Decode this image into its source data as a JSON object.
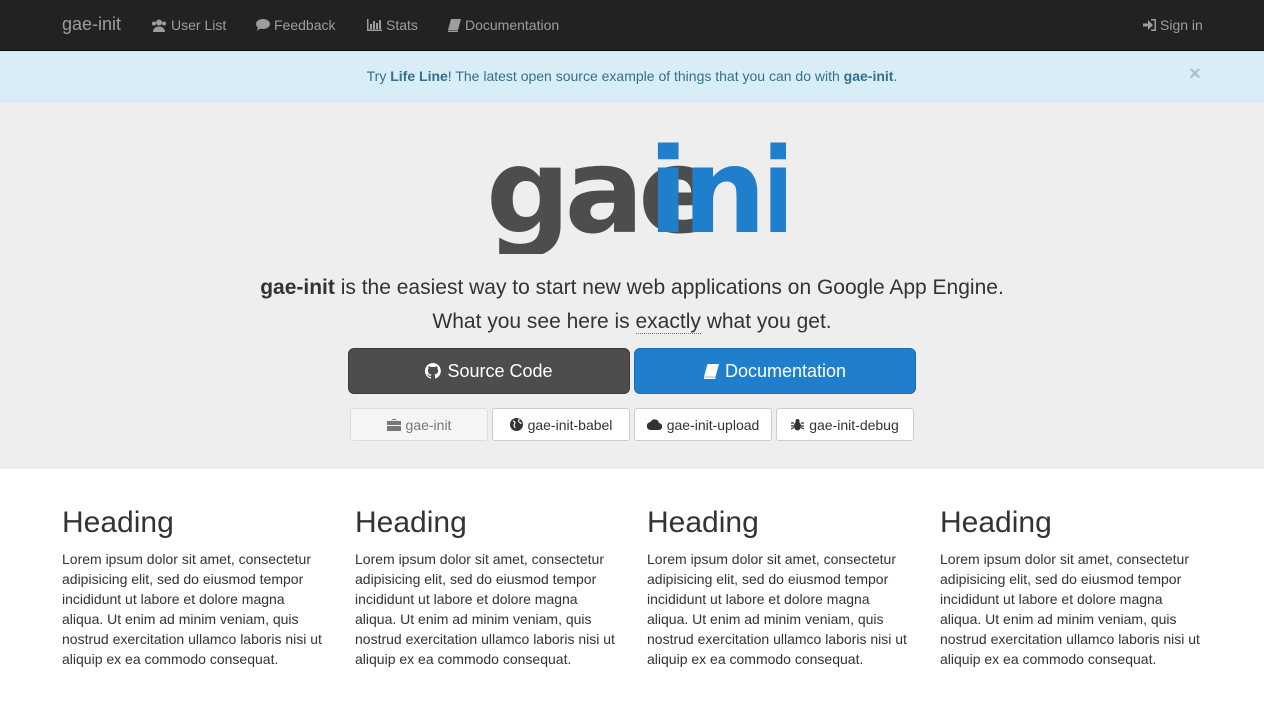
{
  "navbar": {
    "brand": "gae-init",
    "items": [
      {
        "label": "User List",
        "icon": "users-icon"
      },
      {
        "label": "Feedback",
        "icon": "comment-icon"
      },
      {
        "label": "Stats",
        "icon": "bar-chart-icon"
      },
      {
        "label": "Documentation",
        "icon": "book-icon"
      }
    ],
    "signin": {
      "label": "Sign in",
      "icon": "sign-in-icon"
    }
  },
  "alert": {
    "prefix": "Try ",
    "link": "Life Line",
    "middle": "! The latest open source example of things that you can do with ",
    "brand": "gae-init",
    "suffix": ".",
    "close": "×"
  },
  "hero": {
    "logo_part1": "gae",
    "logo_part2": "init",
    "lead_brand": "gae-init",
    "lead_text": " is the easiest way to start new web applications on Google App Engine.",
    "line2_a": "What you see here is ",
    "line2_abbr": "exactly",
    "line2_b": " what you get.",
    "source_button": "Source Code",
    "docs_button": "Documentation",
    "variants": [
      {
        "label": "gae-init",
        "icon": "briefcase-icon",
        "active": true
      },
      {
        "label": "gae-init-babel",
        "icon": "globe-icon",
        "active": false
      },
      {
        "label": "gae-init-upload",
        "icon": "cloud-icon",
        "active": false
      },
      {
        "label": "gae-init-debug",
        "icon": "bug-icon",
        "active": false
      }
    ]
  },
  "columns": [
    {
      "heading": "Heading",
      "text": "Lorem ipsum dolor sit amet, consectetur adipisicing elit, sed do eiusmod tempor incididunt ut labore et dolore magna aliqua. Ut enim ad minim veniam, quis nostrud exercitation ullamco laboris nisi ut aliquip ex ea commodo consequat."
    },
    {
      "heading": "Heading",
      "text": "Lorem ipsum dolor sit amet, consectetur adipisicing elit, sed do eiusmod tempor incididunt ut labore et dolore magna aliqua. Ut enim ad minim veniam, quis nostrud exercitation ullamco laboris nisi ut aliquip ex ea commodo consequat."
    },
    {
      "heading": "Heading",
      "text": "Lorem ipsum dolor sit amet, consectetur adipisicing elit, sed do eiusmod tempor incididunt ut labore et dolore magna aliqua. Ut enim ad minim veniam, quis nostrud exercitation ullamco laboris nisi ut aliquip ex ea commodo consequat."
    },
    {
      "heading": "Heading",
      "text": "Lorem ipsum dolor sit amet, consectetur adipisicing elit, sed do eiusmod tempor incididunt ut labore et dolore magna aliqua. Ut enim ad minim veniam, quis nostrud exercitation ullamco laboris nisi ut aliquip ex ea commodo consequat."
    }
  ],
  "colors": {
    "navbar_bg": "#222222",
    "alert_bg": "#d9edf7",
    "alert_text": "#31708f",
    "jumbotron_bg": "#eeeeee",
    "logo_gray": "#4d4d4d",
    "logo_blue": "#1f7fcd",
    "primary": "#1f7fcd"
  }
}
